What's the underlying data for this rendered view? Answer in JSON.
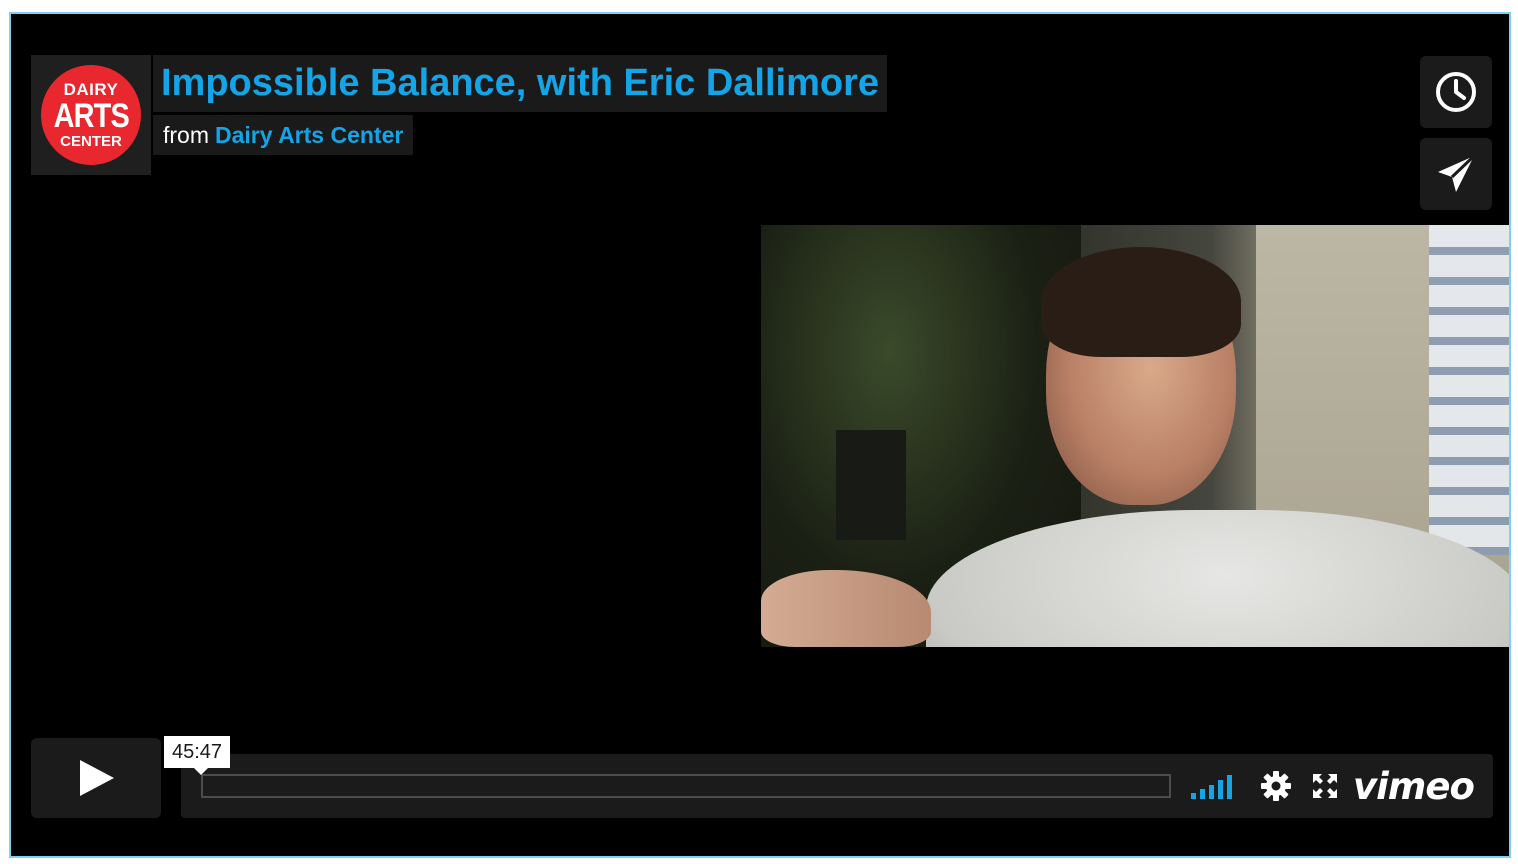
{
  "logo": {
    "line1": "DAIRY",
    "line2": "ARTS",
    "line3": "CENTER",
    "color": "#e8282e"
  },
  "video": {
    "title": "Impossible Balance, with Eric Dallimore",
    "byline_prefix": "from",
    "byline_channel": "Dairy Arts Center"
  },
  "side_buttons": {
    "watch_later_icon": "clock-icon",
    "share_icon": "paper-plane-icon"
  },
  "player": {
    "duration": "45:47",
    "progress_fraction": 0,
    "volume_bars": 5,
    "settings_icon": "gear-icon",
    "fullscreen_icon": "fullscreen-icon",
    "brand": "vimeo",
    "accent": "#13a5e8"
  }
}
